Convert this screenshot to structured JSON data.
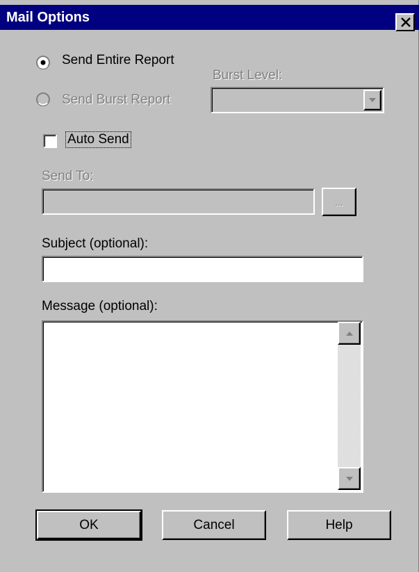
{
  "window": {
    "title": "Mail Options"
  },
  "options": {
    "send_entire_label": "Send Entire Report",
    "send_entire_selected": true,
    "send_burst_label": "Send Burst Report",
    "send_burst_enabled": false,
    "burst_level_label": "Burst Level:",
    "burst_level_value": ""
  },
  "auto_send": {
    "label": "Auto Send",
    "checked": false
  },
  "send_to": {
    "label": "Send To:",
    "value": "",
    "browse_label": "..."
  },
  "subject": {
    "label": "Subject (optional):",
    "value": ""
  },
  "message": {
    "label": "Message (optional):",
    "value": ""
  },
  "buttons": {
    "ok": "OK",
    "cancel": "Cancel",
    "help": "Help"
  },
  "colors": {
    "titlebar": "#000080",
    "face": "#c0c0c0",
    "disabled_text": "#808080"
  },
  "icons": [
    "close-icon",
    "radio-selected-icon",
    "radio-disabled-icon",
    "dropdown-arrow-icon",
    "scroll-up-icon",
    "scroll-down-icon"
  ]
}
